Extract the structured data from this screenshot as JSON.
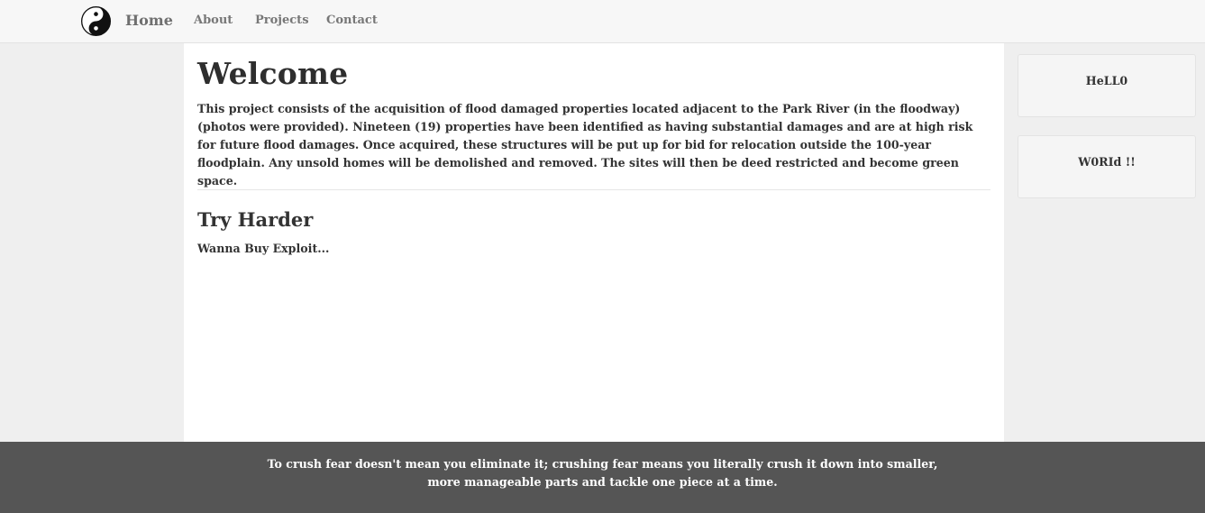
{
  "nav": {
    "logo_icon": "yin-yang-icon",
    "home": "Home",
    "about": "About",
    "projects": "Projects",
    "contact": "Contact"
  },
  "main": {
    "title": "Welcome",
    "paragraph": "This project consists of the acquisition of flood damaged properties located adjacent to the Park River (in the floodway) (photos were provided). Nineteen (19) properties have been identified as having substantial damages and are at high risk for future flood damages. Once acquired, these structures will be put up for bid for relocation outside the 100-year floodplain. Any unsold homes will be demolished and removed. The sites will then be deed restricted and become green space.",
    "subtitle": "Try Harder",
    "subtext": "Wanna Buy Exploit..."
  },
  "sidebar": {
    "widgets": [
      {
        "label": "HeLL0"
      },
      {
        "label": "W0RId !!"
      }
    ]
  },
  "footer": {
    "line1": "To crush fear doesn't mean you eliminate it; crushing fear means you literally crush it down into smaller,",
    "line2": "more manageable parts and tackle one piece at a time."
  },
  "colors": {
    "navbar_bg": "#f7f7f7",
    "page_bg": "#efefef",
    "panel_bg": "#ffffff",
    "footer_bg": "#555555"
  }
}
